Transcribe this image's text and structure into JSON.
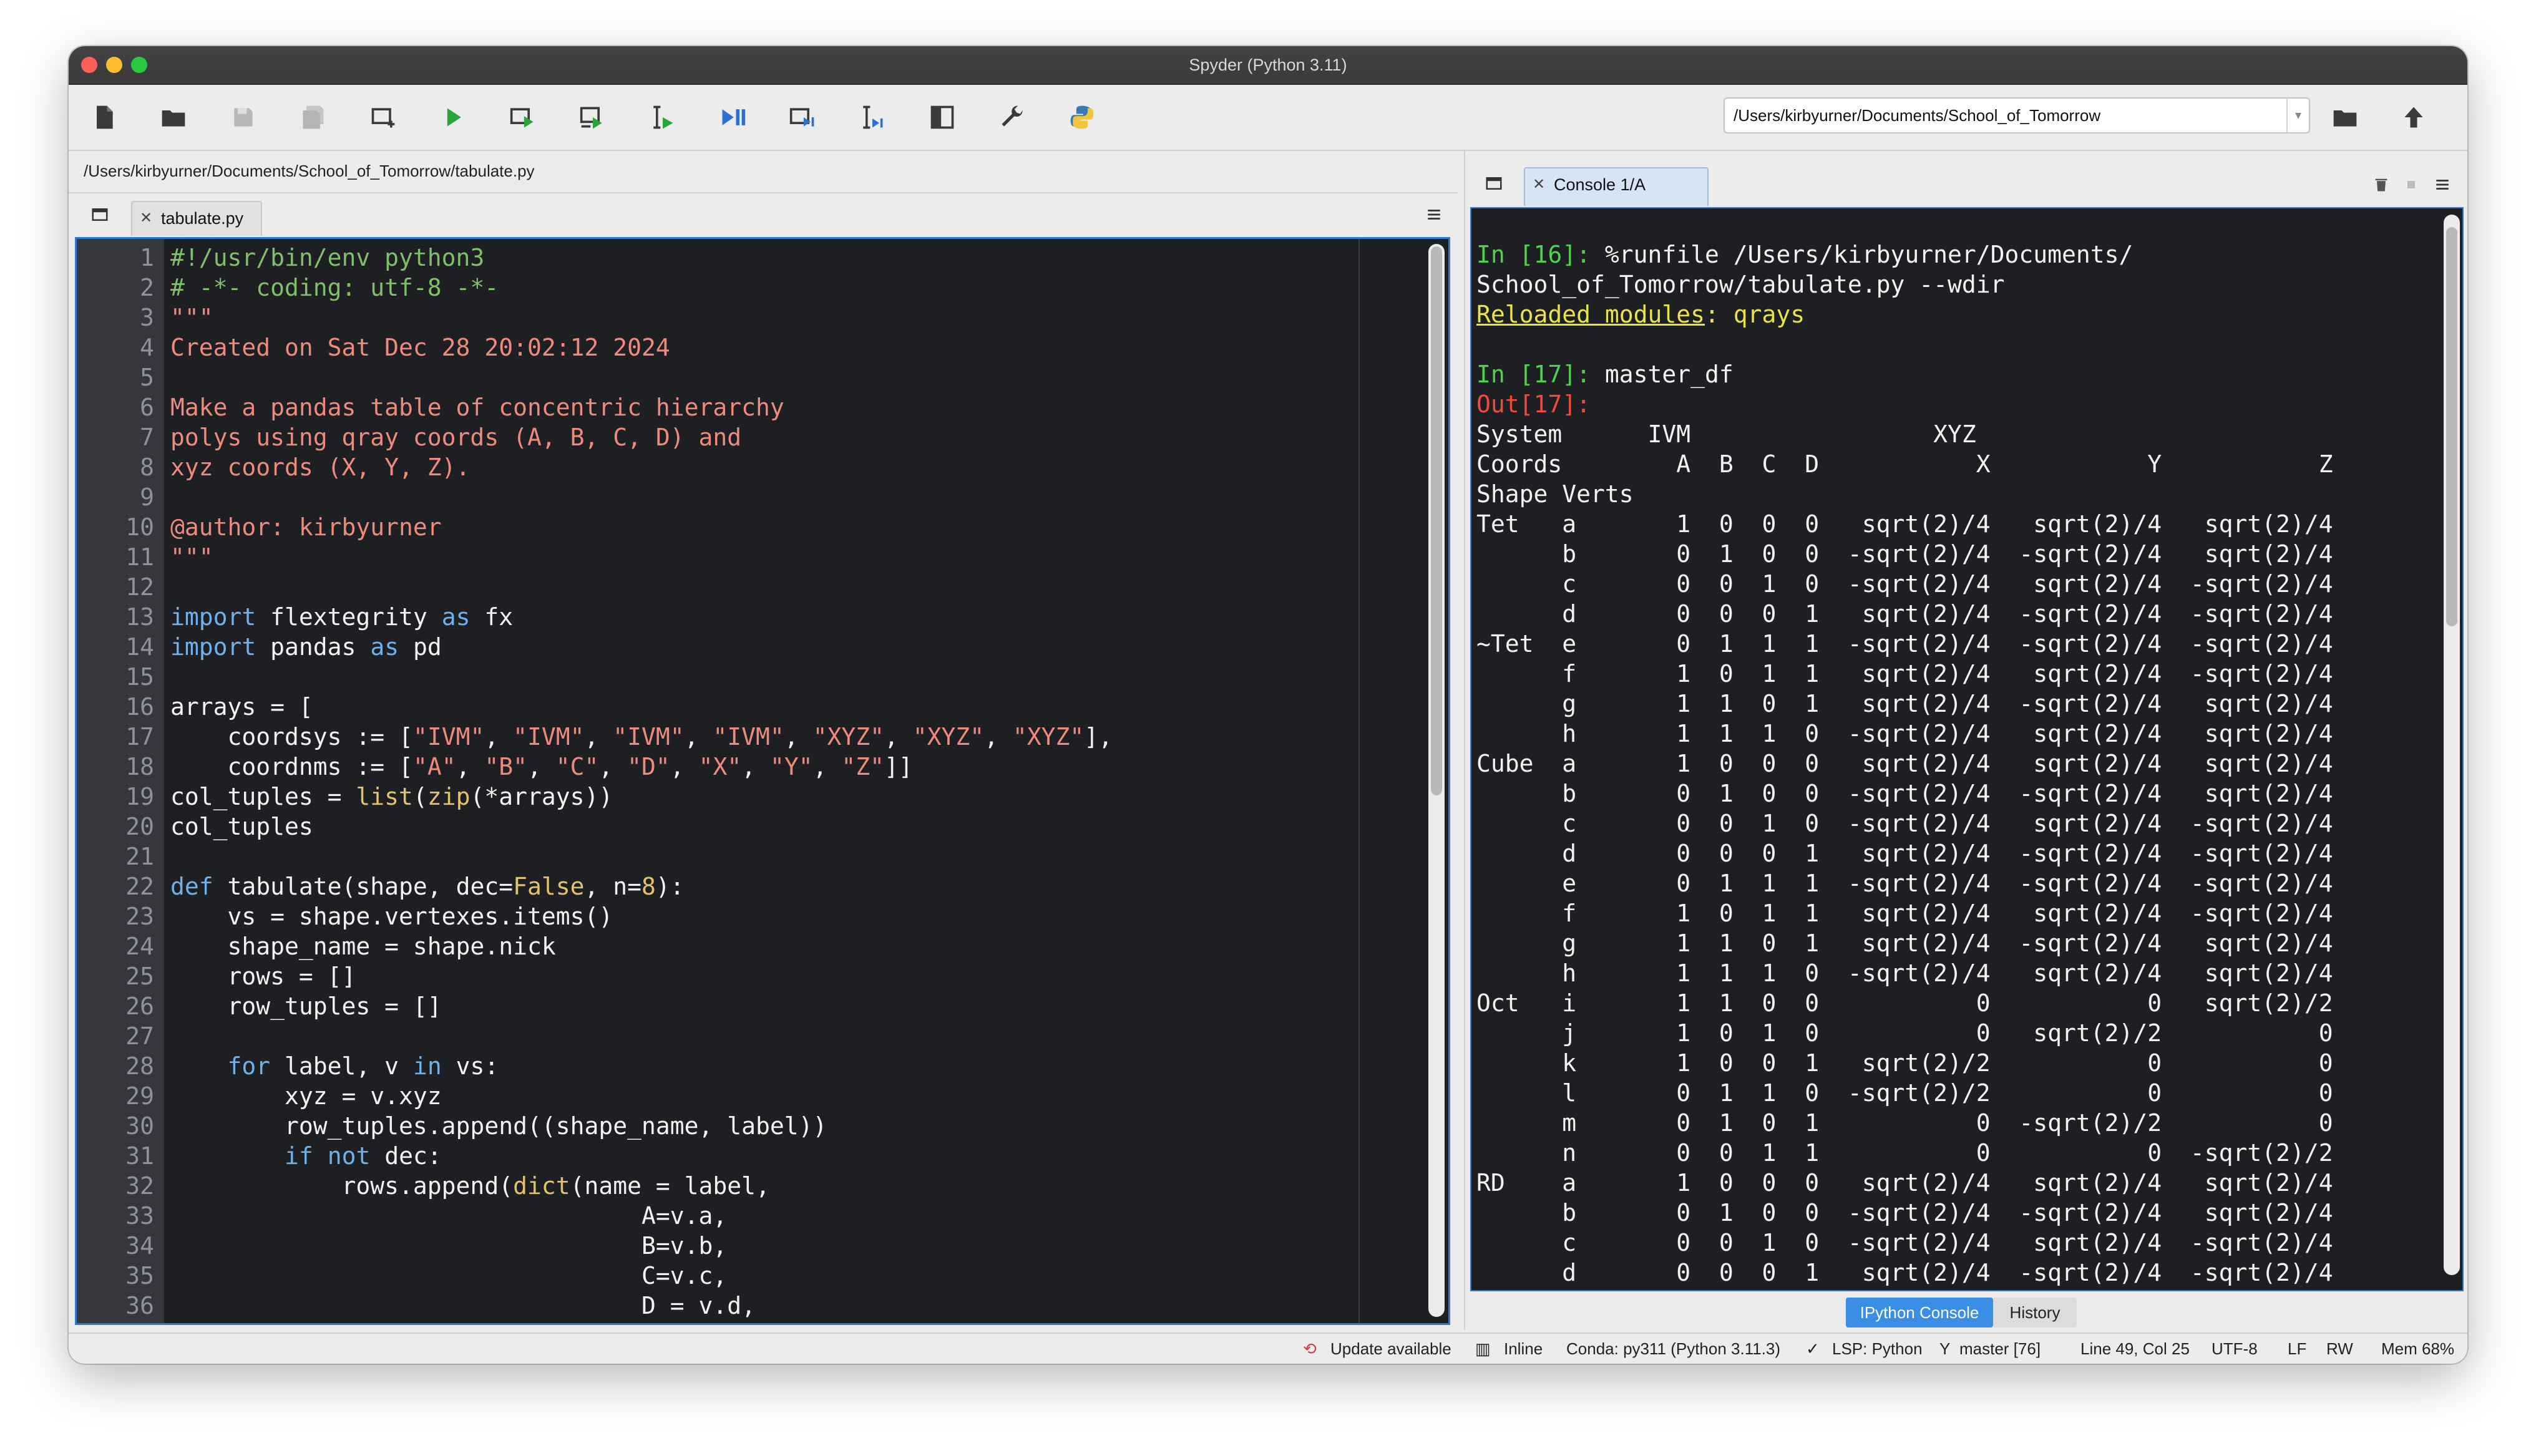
{
  "window": {
    "title": "Spyder (Python 3.11)"
  },
  "toolbar": {
    "working_dir": "/Users/kirbyurner/Documents/School_of_Tomorrow",
    "icons": [
      "new-file-icon",
      "open-file-icon",
      "save-icon",
      "save-all-icon",
      "new-cell-icon",
      "run-icon",
      "run-cell-icon",
      "run-cell-advance-icon",
      "run-selection-icon",
      "debug-icon",
      "debug-cell-icon",
      "debug-selection-icon",
      "maximize-pane-icon",
      "preferences-icon",
      "python-path-icon"
    ]
  },
  "editor": {
    "file_path": "/Users/kirbyurner/Documents/School_of_Tomorrow/tabulate.py",
    "tab_label": "tabulate.py",
    "line_numbers": [
      "1",
      "2",
      "3",
      "4",
      "5",
      "6",
      "7",
      "8",
      "9",
      "10",
      "11",
      "12",
      "13",
      "14",
      "15",
      "16",
      "17",
      "18",
      "19",
      "20",
      "21",
      "22",
      "23",
      "24",
      "25",
      "26",
      "27",
      "28",
      "29",
      "30",
      "31",
      "32",
      "33",
      "34",
      "35",
      "36"
    ],
    "lines": [
      [
        {
          "t": "#!/usr/bin/env python3",
          "c": "comment"
        }
      ],
      [
        {
          "t": "# -*- coding: utf-8 -*-",
          "c": "comment"
        }
      ],
      [
        {
          "t": "\"\"\"",
          "c": "str"
        }
      ],
      [
        {
          "t": "Created on Sat Dec 28 20:02:12 2024",
          "c": "str"
        }
      ],
      [
        {
          "t": "",
          "c": ""
        }
      ],
      [
        {
          "t": "Make a pandas table of concentric hierarchy",
          "c": "str"
        }
      ],
      [
        {
          "t": "polys using qray coords (A, B, C, D) and",
          "c": "str"
        }
      ],
      [
        {
          "t": "xyz coords (X, Y, Z).",
          "c": "str"
        }
      ],
      [
        {
          "t": "",
          "c": ""
        }
      ],
      [
        {
          "t": "@author: kirbyurner",
          "c": "str"
        }
      ],
      [
        {
          "t": "\"\"\"",
          "c": "str"
        }
      ],
      [
        {
          "t": "",
          "c": ""
        }
      ],
      [
        {
          "t": "import",
          "c": "kw"
        },
        {
          "t": " flextegrity ",
          "c": ""
        },
        {
          "t": "as",
          "c": "kw"
        },
        {
          "t": " fx",
          "c": ""
        }
      ],
      [
        {
          "t": "import",
          "c": "kw"
        },
        {
          "t": " pandas ",
          "c": ""
        },
        {
          "t": "as",
          "c": "kw"
        },
        {
          "t": " pd",
          "c": ""
        }
      ],
      [
        {
          "t": "",
          "c": ""
        }
      ],
      [
        {
          "t": "arrays = [",
          "c": ""
        }
      ],
      [
        {
          "t": "    coordsys := [",
          "c": ""
        },
        {
          "t": "\"IVM\"",
          "c": "str"
        },
        {
          "t": ", ",
          "c": ""
        },
        {
          "t": "\"IVM\"",
          "c": "str"
        },
        {
          "t": ", ",
          "c": ""
        },
        {
          "t": "\"IVM\"",
          "c": "str"
        },
        {
          "t": ", ",
          "c": ""
        },
        {
          "t": "\"IVM\"",
          "c": "str"
        },
        {
          "t": ", ",
          "c": ""
        },
        {
          "t": "\"XYZ\"",
          "c": "str"
        },
        {
          "t": ", ",
          "c": ""
        },
        {
          "t": "\"XYZ\"",
          "c": "str"
        },
        {
          "t": ", ",
          "c": ""
        },
        {
          "t": "\"XYZ\"",
          "c": "str"
        },
        {
          "t": "],",
          "c": ""
        }
      ],
      [
        {
          "t": "    coordnms := [",
          "c": ""
        },
        {
          "t": "\"A\"",
          "c": "str"
        },
        {
          "t": ", ",
          "c": ""
        },
        {
          "t": "\"B\"",
          "c": "str"
        },
        {
          "t": ", ",
          "c": ""
        },
        {
          "t": "\"C\"",
          "c": "str"
        },
        {
          "t": ", ",
          "c": ""
        },
        {
          "t": "\"D\"",
          "c": "str"
        },
        {
          "t": ", ",
          "c": ""
        },
        {
          "t": "\"X\"",
          "c": "str"
        },
        {
          "t": ", ",
          "c": ""
        },
        {
          "t": "\"Y\"",
          "c": "str"
        },
        {
          "t": ", ",
          "c": ""
        },
        {
          "t": "\"Z\"",
          "c": "str"
        },
        {
          "t": "]]",
          "c": ""
        }
      ],
      [
        {
          "t": "col_tuples = ",
          "c": ""
        },
        {
          "t": "list",
          "c": "bi"
        },
        {
          "t": "(",
          "c": ""
        },
        {
          "t": "zip",
          "c": "bi"
        },
        {
          "t": "(*arrays))",
          "c": ""
        }
      ],
      [
        {
          "t": "col_tuples",
          "c": ""
        }
      ],
      [
        {
          "t": "",
          "c": ""
        }
      ],
      [
        {
          "t": "def",
          "c": "kw"
        },
        {
          "t": " tabulate(shape, dec=",
          "c": ""
        },
        {
          "t": "False",
          "c": "bi"
        },
        {
          "t": ", n=",
          "c": ""
        },
        {
          "t": "8",
          "c": "num"
        },
        {
          "t": "):",
          "c": ""
        }
      ],
      [
        {
          "t": "    vs = shape.vertexes.items()",
          "c": ""
        }
      ],
      [
        {
          "t": "    shape_name = shape.nick",
          "c": ""
        }
      ],
      [
        {
          "t": "    rows = []",
          "c": ""
        }
      ],
      [
        {
          "t": "    row_tuples = []",
          "c": ""
        }
      ],
      [
        {
          "t": "",
          "c": ""
        }
      ],
      [
        {
          "t": "    ",
          "c": ""
        },
        {
          "t": "for",
          "c": "kw"
        },
        {
          "t": " label, v ",
          "c": ""
        },
        {
          "t": "in",
          "c": "kw"
        },
        {
          "t": " vs:",
          "c": ""
        }
      ],
      [
        {
          "t": "        xyz = v.xyz",
          "c": ""
        }
      ],
      [
        {
          "t": "        row_tuples.append((shape_name, label))",
          "c": ""
        }
      ],
      [
        {
          "t": "        ",
          "c": ""
        },
        {
          "t": "if",
          "c": "kw"
        },
        {
          "t": " ",
          "c": ""
        },
        {
          "t": "not",
          "c": "kw"
        },
        {
          "t": " dec:",
          "c": ""
        }
      ],
      [
        {
          "t": "            rows.append(",
          "c": ""
        },
        {
          "t": "dict",
          "c": "bi"
        },
        {
          "t": "(name = label,",
          "c": ""
        }
      ],
      [
        {
          "t": "                                 A=v.a,",
          "c": ""
        }
      ],
      [
        {
          "t": "                                 B=v.b,",
          "c": ""
        }
      ],
      [
        {
          "t": "                                 C=v.c,",
          "c": ""
        }
      ],
      [
        {
          "t": "                                 D = v.d,",
          "c": ""
        }
      ]
    ]
  },
  "console": {
    "tab_label": "Console 1/A",
    "lines": [
      [
        {
          "t": "In [16]: ",
          "c": "in"
        },
        {
          "t": "%runfile /Users/kirbyurner/Documents/",
          "c": ""
        }
      ],
      [
        {
          "t": "School_of_Tomorrow/tabulate.py --wdir",
          "c": ""
        }
      ],
      [
        {
          "t": "Reloaded modules",
          "c": "rel-u"
        },
        {
          "t": ": qrays",
          "c": "rel"
        }
      ],
      [
        {
          "t": "",
          "c": ""
        }
      ],
      [
        {
          "t": "In [17]: ",
          "c": "in"
        },
        {
          "t": "master_df",
          "c": ""
        }
      ],
      [
        {
          "t": "Out[17]:",
          "c": "out"
        }
      ],
      [
        {
          "t": "System      IVM                 XYZ",
          "c": ""
        }
      ],
      [
        {
          "t": "Coords        A  B  C  D           X           Y           Z",
          "c": ""
        }
      ],
      [
        {
          "t": "Shape Verts",
          "c": ""
        }
      ],
      [
        {
          "t": "Tet   a       1  0  0  0   sqrt(2)/4   sqrt(2)/4   sqrt(2)/4",
          "c": ""
        }
      ],
      [
        {
          "t": "      b       0  1  0  0  -sqrt(2)/4  -sqrt(2)/4   sqrt(2)/4",
          "c": ""
        }
      ],
      [
        {
          "t": "      c       0  0  1  0  -sqrt(2)/4   sqrt(2)/4  -sqrt(2)/4",
          "c": ""
        }
      ],
      [
        {
          "t": "      d       0  0  0  1   sqrt(2)/4  -sqrt(2)/4  -sqrt(2)/4",
          "c": ""
        }
      ],
      [
        {
          "t": "~Tet  e       0  1  1  1  -sqrt(2)/4  -sqrt(2)/4  -sqrt(2)/4",
          "c": ""
        }
      ],
      [
        {
          "t": "      f       1  0  1  1   sqrt(2)/4   sqrt(2)/4  -sqrt(2)/4",
          "c": ""
        }
      ],
      [
        {
          "t": "      g       1  1  0  1   sqrt(2)/4  -sqrt(2)/4   sqrt(2)/4",
          "c": ""
        }
      ],
      [
        {
          "t": "      h       1  1  1  0  -sqrt(2)/4   sqrt(2)/4   sqrt(2)/4",
          "c": ""
        }
      ],
      [
        {
          "t": "Cube  a       1  0  0  0   sqrt(2)/4   sqrt(2)/4   sqrt(2)/4",
          "c": ""
        }
      ],
      [
        {
          "t": "      b       0  1  0  0  -sqrt(2)/4  -sqrt(2)/4   sqrt(2)/4",
          "c": ""
        }
      ],
      [
        {
          "t": "      c       0  0  1  0  -sqrt(2)/4   sqrt(2)/4  -sqrt(2)/4",
          "c": ""
        }
      ],
      [
        {
          "t": "      d       0  0  0  1   sqrt(2)/4  -sqrt(2)/4  -sqrt(2)/4",
          "c": ""
        }
      ],
      [
        {
          "t": "      e       0  1  1  1  -sqrt(2)/4  -sqrt(2)/4  -sqrt(2)/4",
          "c": ""
        }
      ],
      [
        {
          "t": "      f       1  0  1  1   sqrt(2)/4   sqrt(2)/4  -sqrt(2)/4",
          "c": ""
        }
      ],
      [
        {
          "t": "      g       1  1  0  1   sqrt(2)/4  -sqrt(2)/4   sqrt(2)/4",
          "c": ""
        }
      ],
      [
        {
          "t": "      h       1  1  1  0  -sqrt(2)/4   sqrt(2)/4   sqrt(2)/4",
          "c": ""
        }
      ],
      [
        {
          "t": "Oct   i       1  1  0  0           0           0   sqrt(2)/2",
          "c": ""
        }
      ],
      [
        {
          "t": "      j       1  0  1  0           0   sqrt(2)/2           0",
          "c": ""
        }
      ],
      [
        {
          "t": "      k       1  0  0  1   sqrt(2)/2           0           0",
          "c": ""
        }
      ],
      [
        {
          "t": "      l       0  1  1  0  -sqrt(2)/2           0           0",
          "c": ""
        }
      ],
      [
        {
          "t": "      m       0  1  0  1           0  -sqrt(2)/2           0",
          "c": ""
        }
      ],
      [
        {
          "t": "      n       0  0  1  1           0           0  -sqrt(2)/2",
          "c": ""
        }
      ],
      [
        {
          "t": "RD    a       1  0  0  0   sqrt(2)/4   sqrt(2)/4   sqrt(2)/4",
          "c": ""
        }
      ],
      [
        {
          "t": "      b       0  1  0  0  -sqrt(2)/4  -sqrt(2)/4   sqrt(2)/4",
          "c": ""
        }
      ],
      [
        {
          "t": "      c       0  0  1  0  -sqrt(2)/4   sqrt(2)/4  -sqrt(2)/4",
          "c": ""
        }
      ],
      [
        {
          "t": "      d       0  0  0  1   sqrt(2)/4  -sqrt(2)/4  -sqrt(2)/4",
          "c": ""
        }
      ]
    ],
    "bottom_tabs": [
      "IPython Console",
      "History"
    ]
  },
  "status": {
    "update": "Update available",
    "inline": "Inline",
    "conda": "Conda: py311 (Python 3.11.3)",
    "lsp": "LSP: Python",
    "git": "master [76]",
    "position": "Line 49, Col 25",
    "encoding": "UTF-8",
    "eol": "LF",
    "mode": "RW",
    "mem": "Mem 68%"
  },
  "colors": {
    "close": "#fe5f57",
    "minimize": "#febc2e",
    "zoom": "#28c840",
    "accent": "#2e7bd6",
    "editor_bg": "#1e1f22"
  }
}
